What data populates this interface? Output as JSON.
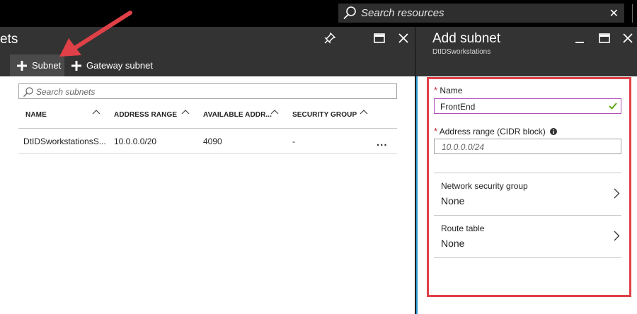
{
  "topbar": {
    "search_placeholder": "Search resources",
    "clear_label": "✕"
  },
  "left_blade": {
    "title": "ets",
    "commands": [
      {
        "label": "Subnet"
      },
      {
        "label": "Gateway subnet"
      }
    ],
    "search_placeholder": "Search subnets",
    "columns": [
      "NAME",
      "ADDRESS RANGE",
      "AVAILABLE ADDR...",
      "SECURITY GROUP"
    ],
    "rows": [
      {
        "name": "DtIDSworkstationsS...",
        "address_range": "10.0.0.0/20",
        "available": "4090",
        "security_group": "-",
        "more": "..."
      }
    ]
  },
  "right_blade": {
    "title": "Add subnet",
    "subtitle": "DtIDSworkstations",
    "required_mark": "*",
    "name_label": "Name",
    "name_value": "FrontEnd",
    "address_label": "Address range (CIDR block)",
    "address_placeholder": "10.0.0.0/24",
    "nav_items": [
      {
        "label": "Network security group",
        "value": "None"
      },
      {
        "label": "Route table",
        "value": "None"
      }
    ]
  },
  "colors": {
    "chrome_dark": "#333333",
    "topbar": "#000000",
    "annotation_red": "#e04047",
    "required_red": "#c4262e",
    "valid_check": "#57a300",
    "blade_accent": "#2e9ad8"
  },
  "icons": [
    "search-icon",
    "close-icon",
    "pin-icon",
    "maximize-icon",
    "plus-icon",
    "sort-icon",
    "more-icon",
    "checkmark-icon",
    "info-icon",
    "chevron-right-icon",
    "annotation-arrow"
  ]
}
